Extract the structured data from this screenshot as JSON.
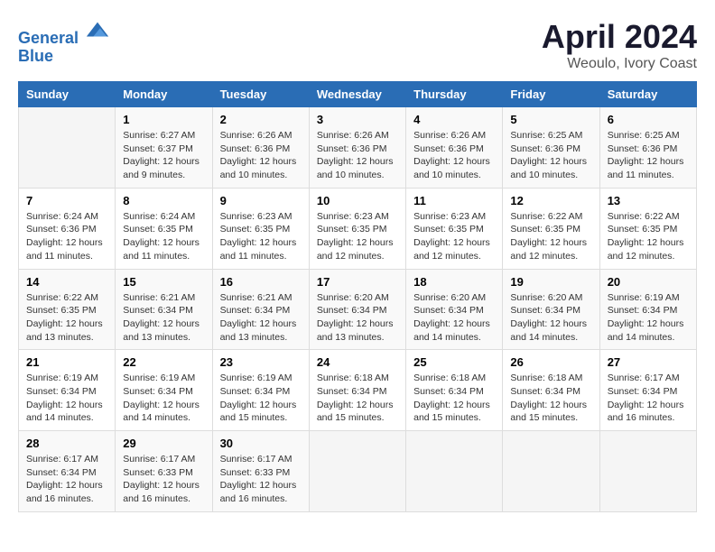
{
  "header": {
    "logo_line1": "General",
    "logo_line2": "Blue",
    "month_year": "April 2024",
    "location": "Weoulo, Ivory Coast"
  },
  "days_of_week": [
    "Sunday",
    "Monday",
    "Tuesday",
    "Wednesday",
    "Thursday",
    "Friday",
    "Saturday"
  ],
  "weeks": [
    [
      {
        "num": "",
        "info": ""
      },
      {
        "num": "1",
        "info": "Sunrise: 6:27 AM\nSunset: 6:37 PM\nDaylight: 12 hours\nand 9 minutes."
      },
      {
        "num": "2",
        "info": "Sunrise: 6:26 AM\nSunset: 6:36 PM\nDaylight: 12 hours\nand 10 minutes."
      },
      {
        "num": "3",
        "info": "Sunrise: 6:26 AM\nSunset: 6:36 PM\nDaylight: 12 hours\nand 10 minutes."
      },
      {
        "num": "4",
        "info": "Sunrise: 6:26 AM\nSunset: 6:36 PM\nDaylight: 12 hours\nand 10 minutes."
      },
      {
        "num": "5",
        "info": "Sunrise: 6:25 AM\nSunset: 6:36 PM\nDaylight: 12 hours\nand 10 minutes."
      },
      {
        "num": "6",
        "info": "Sunrise: 6:25 AM\nSunset: 6:36 PM\nDaylight: 12 hours\nand 11 minutes."
      }
    ],
    [
      {
        "num": "7",
        "info": "Sunrise: 6:24 AM\nSunset: 6:36 PM\nDaylight: 12 hours\nand 11 minutes."
      },
      {
        "num": "8",
        "info": "Sunrise: 6:24 AM\nSunset: 6:35 PM\nDaylight: 12 hours\nand 11 minutes."
      },
      {
        "num": "9",
        "info": "Sunrise: 6:23 AM\nSunset: 6:35 PM\nDaylight: 12 hours\nand 11 minutes."
      },
      {
        "num": "10",
        "info": "Sunrise: 6:23 AM\nSunset: 6:35 PM\nDaylight: 12 hours\nand 12 minutes."
      },
      {
        "num": "11",
        "info": "Sunrise: 6:23 AM\nSunset: 6:35 PM\nDaylight: 12 hours\nand 12 minutes."
      },
      {
        "num": "12",
        "info": "Sunrise: 6:22 AM\nSunset: 6:35 PM\nDaylight: 12 hours\nand 12 minutes."
      },
      {
        "num": "13",
        "info": "Sunrise: 6:22 AM\nSunset: 6:35 PM\nDaylight: 12 hours\nand 12 minutes."
      }
    ],
    [
      {
        "num": "14",
        "info": "Sunrise: 6:22 AM\nSunset: 6:35 PM\nDaylight: 12 hours\nand 13 minutes."
      },
      {
        "num": "15",
        "info": "Sunrise: 6:21 AM\nSunset: 6:34 PM\nDaylight: 12 hours\nand 13 minutes."
      },
      {
        "num": "16",
        "info": "Sunrise: 6:21 AM\nSunset: 6:34 PM\nDaylight: 12 hours\nand 13 minutes."
      },
      {
        "num": "17",
        "info": "Sunrise: 6:20 AM\nSunset: 6:34 PM\nDaylight: 12 hours\nand 13 minutes."
      },
      {
        "num": "18",
        "info": "Sunrise: 6:20 AM\nSunset: 6:34 PM\nDaylight: 12 hours\nand 14 minutes."
      },
      {
        "num": "19",
        "info": "Sunrise: 6:20 AM\nSunset: 6:34 PM\nDaylight: 12 hours\nand 14 minutes."
      },
      {
        "num": "20",
        "info": "Sunrise: 6:19 AM\nSunset: 6:34 PM\nDaylight: 12 hours\nand 14 minutes."
      }
    ],
    [
      {
        "num": "21",
        "info": "Sunrise: 6:19 AM\nSunset: 6:34 PM\nDaylight: 12 hours\nand 14 minutes."
      },
      {
        "num": "22",
        "info": "Sunrise: 6:19 AM\nSunset: 6:34 PM\nDaylight: 12 hours\nand 14 minutes."
      },
      {
        "num": "23",
        "info": "Sunrise: 6:19 AM\nSunset: 6:34 PM\nDaylight: 12 hours\nand 15 minutes."
      },
      {
        "num": "24",
        "info": "Sunrise: 6:18 AM\nSunset: 6:34 PM\nDaylight: 12 hours\nand 15 minutes."
      },
      {
        "num": "25",
        "info": "Sunrise: 6:18 AM\nSunset: 6:34 PM\nDaylight: 12 hours\nand 15 minutes."
      },
      {
        "num": "26",
        "info": "Sunrise: 6:18 AM\nSunset: 6:34 PM\nDaylight: 12 hours\nand 15 minutes."
      },
      {
        "num": "27",
        "info": "Sunrise: 6:17 AM\nSunset: 6:34 PM\nDaylight: 12 hours\nand 16 minutes."
      }
    ],
    [
      {
        "num": "28",
        "info": "Sunrise: 6:17 AM\nSunset: 6:34 PM\nDaylight: 12 hours\nand 16 minutes."
      },
      {
        "num": "29",
        "info": "Sunrise: 6:17 AM\nSunset: 6:33 PM\nDaylight: 12 hours\nand 16 minutes."
      },
      {
        "num": "30",
        "info": "Sunrise: 6:17 AM\nSunset: 6:33 PM\nDaylight: 12 hours\nand 16 minutes."
      },
      {
        "num": "",
        "info": ""
      },
      {
        "num": "",
        "info": ""
      },
      {
        "num": "",
        "info": ""
      },
      {
        "num": "",
        "info": ""
      }
    ]
  ]
}
